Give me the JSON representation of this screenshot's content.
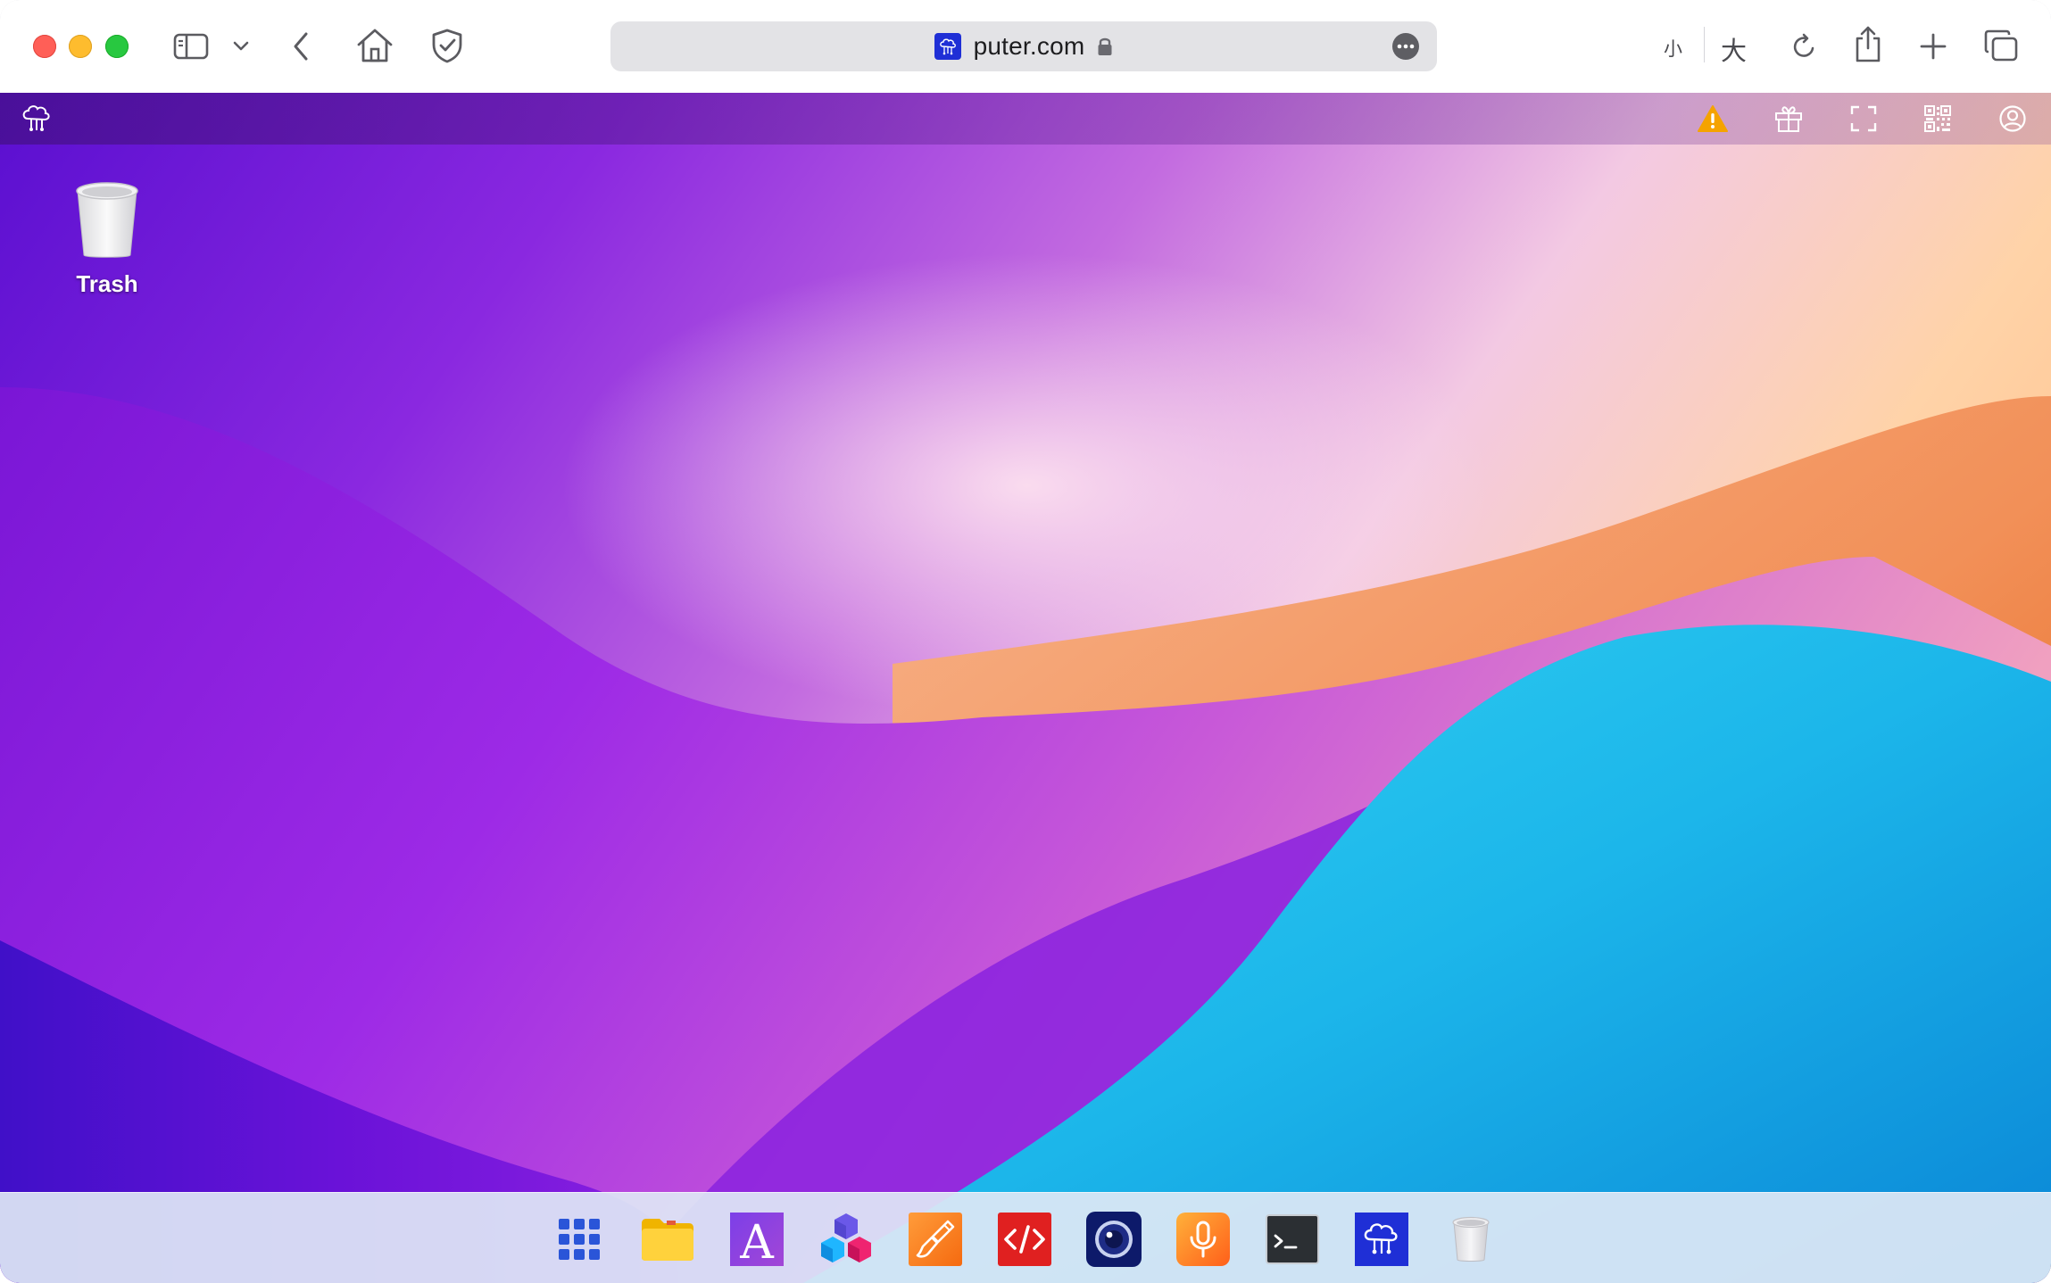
{
  "browser": {
    "url": "puter.com",
    "text_size_small": "小",
    "text_size_large": "大"
  },
  "desktop": {
    "items": [
      {
        "label": "Trash",
        "icon": "trash-icon"
      }
    ]
  },
  "puter_topbar": {
    "icons": [
      "puter-logo-icon",
      "warning-icon",
      "gift-icon",
      "fullscreen-icon",
      "qr-code-icon",
      "user-icon"
    ]
  },
  "taskbar": {
    "apps": [
      "app-launcher-grid-icon",
      "files-folder-icon",
      "editor-a-icon",
      "blocks-cubes-icon",
      "paint-brush-icon",
      "code-editor-icon",
      "camera-icon",
      "recorder-mic-icon",
      "terminal-icon",
      "puter-logo-icon",
      "trash-icon"
    ]
  },
  "colors": {
    "warning": "#f5a300",
    "favicon_blue": "#1f2fd6",
    "code_red": "#e02020",
    "camera_navy": "#0d1a6a",
    "recorder_orange": "#ff7a1a"
  }
}
